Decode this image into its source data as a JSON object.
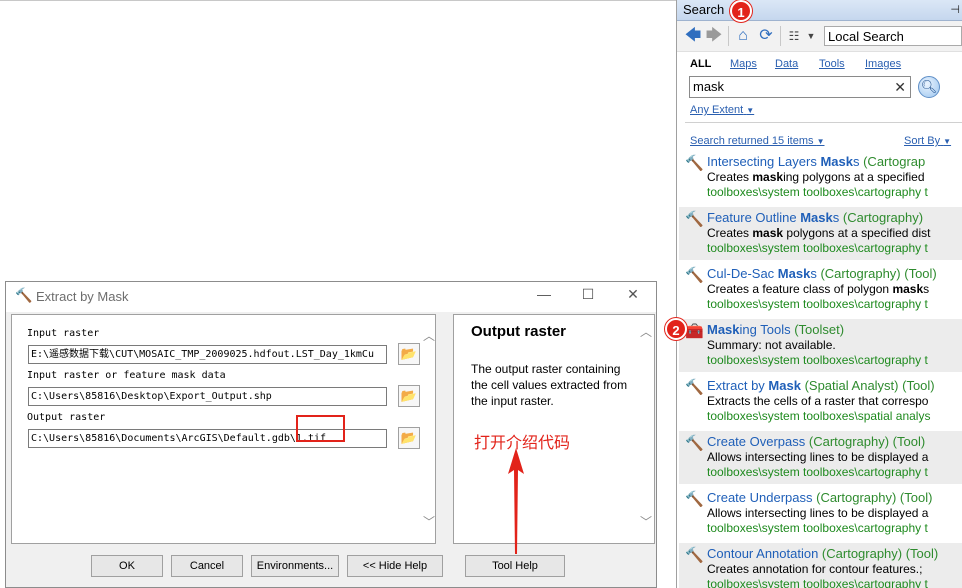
{
  "search_panel": {
    "title": "Search",
    "pin_icon": "pin-icon",
    "scope": "Local Search",
    "tabs": [
      {
        "label": "ALL",
        "active": true
      },
      {
        "label": "Maps",
        "active": false
      },
      {
        "label": "Data",
        "active": false
      },
      {
        "label": "Tools",
        "active": false
      },
      {
        "label": "Images",
        "active": false
      }
    ],
    "query": "mask",
    "extent": "Any Extent",
    "results_count": "Search returned 15 items",
    "sort_label": "Sort By",
    "results": [
      {
        "title_pre": "Intersecting Layers ",
        "title_bold": "Mask",
        "title_post": "s",
        "type": " (Cartograp",
        "desc_pre": "Creates ",
        "desc_bold": "mask",
        "desc_post": "ing polygons at a specified",
        "path": "toolboxes\\system toolboxes\\cartography t",
        "icon": "hammer-icon"
      },
      {
        "title_pre": "Feature Outline ",
        "title_bold": "Mask",
        "title_post": "s",
        "type": " (Cartography)",
        "desc_pre": "Creates ",
        "desc_bold": "mask",
        "desc_post": " polygons at a specified dist",
        "path": "toolboxes\\system toolboxes\\cartography t",
        "icon": "hammer-icon"
      },
      {
        "title_pre": "Cul-De-Sac ",
        "title_bold": "Mask",
        "title_post": "s",
        "type": " (Cartography) (Tool)",
        "desc_pre": "Creates a feature class of polygon ",
        "desc_bold": "mask",
        "desc_post": "s",
        "path": "toolboxes\\system toolboxes\\cartography t",
        "icon": "hammer-icon"
      },
      {
        "title_pre": "",
        "title_bold": "Mask",
        "title_post": "ing Tools",
        "type": " (Toolset)",
        "desc_pre": "Summary: not available.",
        "desc_bold": "",
        "desc_post": "",
        "path": "toolboxes\\system toolboxes\\cartography t",
        "icon": "toolset-icon"
      },
      {
        "title_pre": "Extract by ",
        "title_bold": "Mask",
        "title_post": "",
        "type": " (Spatial Analyst) (Tool)",
        "desc_pre": "Extracts the cells of a raster that correspo",
        "desc_bold": "",
        "desc_post": "",
        "path": "toolboxes\\system toolboxes\\spatial analys",
        "icon": "hammer-icon"
      },
      {
        "title_pre": "Create Overpass",
        "title_bold": "",
        "title_post": "",
        "type": " (Cartography) (Tool)",
        "desc_pre": "Allows intersecting lines to be displayed a",
        "desc_bold": "",
        "desc_post": "",
        "path": "toolboxes\\system toolboxes\\cartography t",
        "icon": "hammer-icon"
      },
      {
        "title_pre": "Create Underpass",
        "title_bold": "",
        "title_post": "",
        "type": " (Cartography) (Tool)",
        "desc_pre": "Allows intersecting lines to be displayed a",
        "desc_bold": "",
        "desc_post": "",
        "path": "toolboxes\\system toolboxes\\cartography t",
        "icon": "hammer-icon"
      },
      {
        "title_pre": "Contour Annotation",
        "title_bold": "",
        "title_post": "",
        "type": " (Cartography) (Tool)",
        "desc_pre": "Creates annotation for contour features.; ",
        "desc_bold": "",
        "desc_post": "",
        "path": "toolboxes\\system toolboxes\\cartography t",
        "icon": "hammer-icon"
      }
    ]
  },
  "badges": {
    "one": "1",
    "two": "2"
  },
  "dialog": {
    "title": "Extract by Mask",
    "params": [
      {
        "label": "Input raster",
        "value": "E:\\遥感数据下载\\CUT\\MOSAIC_TMP_2009025.hdfout.LST_Day_1kmCu"
      },
      {
        "label": "Input raster or feature mask data",
        "value": "C:\\Users\\85816\\Desktop\\Export_Output.shp"
      },
      {
        "label": "Output raster",
        "value": "C:\\Users\\85816\\Documents\\ArcGIS\\Default.gdb\\1.tif"
      }
    ],
    "help": {
      "title": "Output raster",
      "text": "The output raster containing the cell values extracted from the input raster."
    },
    "annotation": "打开介绍代码",
    "buttons": {
      "ok": "OK",
      "cancel": "Cancel",
      "env": "Environments...",
      "hide_help": "<< Hide Help",
      "tool_help": "Tool Help"
    }
  },
  "colors": {
    "accent_red": "#e2231a",
    "link_blue": "#1f5fb8",
    "path_green": "#1e8a1e"
  }
}
